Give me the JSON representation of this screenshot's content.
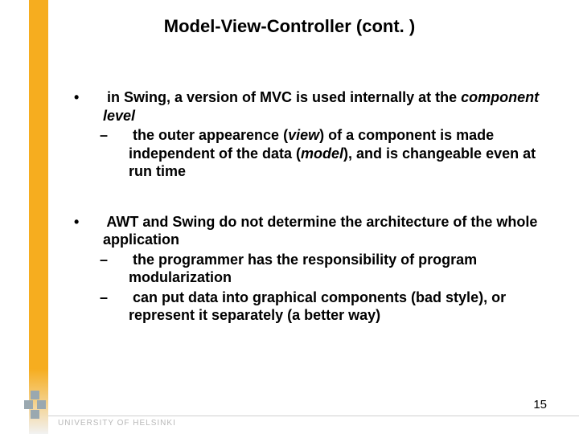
{
  "title": "Model-View-Controller (cont. )",
  "bullets": [
    {
      "line_pre": "in Swing, a version of MVC is used internally at the ",
      "line_em": "component level",
      "line_post": "",
      "subs": [
        {
          "pre": "the outer appearence (",
          "em1": "view",
          "mid": ") of a component is made independent of the data (",
          "em2": "model",
          "post": "), and is changeable even at run time"
        }
      ]
    },
    {
      "line_pre": "AWT and Swing do not determine the architecture of the whole application",
      "line_em": "",
      "line_post": "",
      "subs": [
        {
          "pre": "the programmer has the responsibility of program modularization",
          "em1": "",
          "mid": "",
          "em2": "",
          "post": ""
        },
        {
          "pre": "can put data into graphical components (bad style), or represent it separately (a better way)",
          "em1": "",
          "mid": "",
          "em2": "",
          "post": ""
        }
      ]
    }
  ],
  "footer": {
    "university": "UNIVERSITY OF HELSINKI"
  },
  "page_number": "15"
}
